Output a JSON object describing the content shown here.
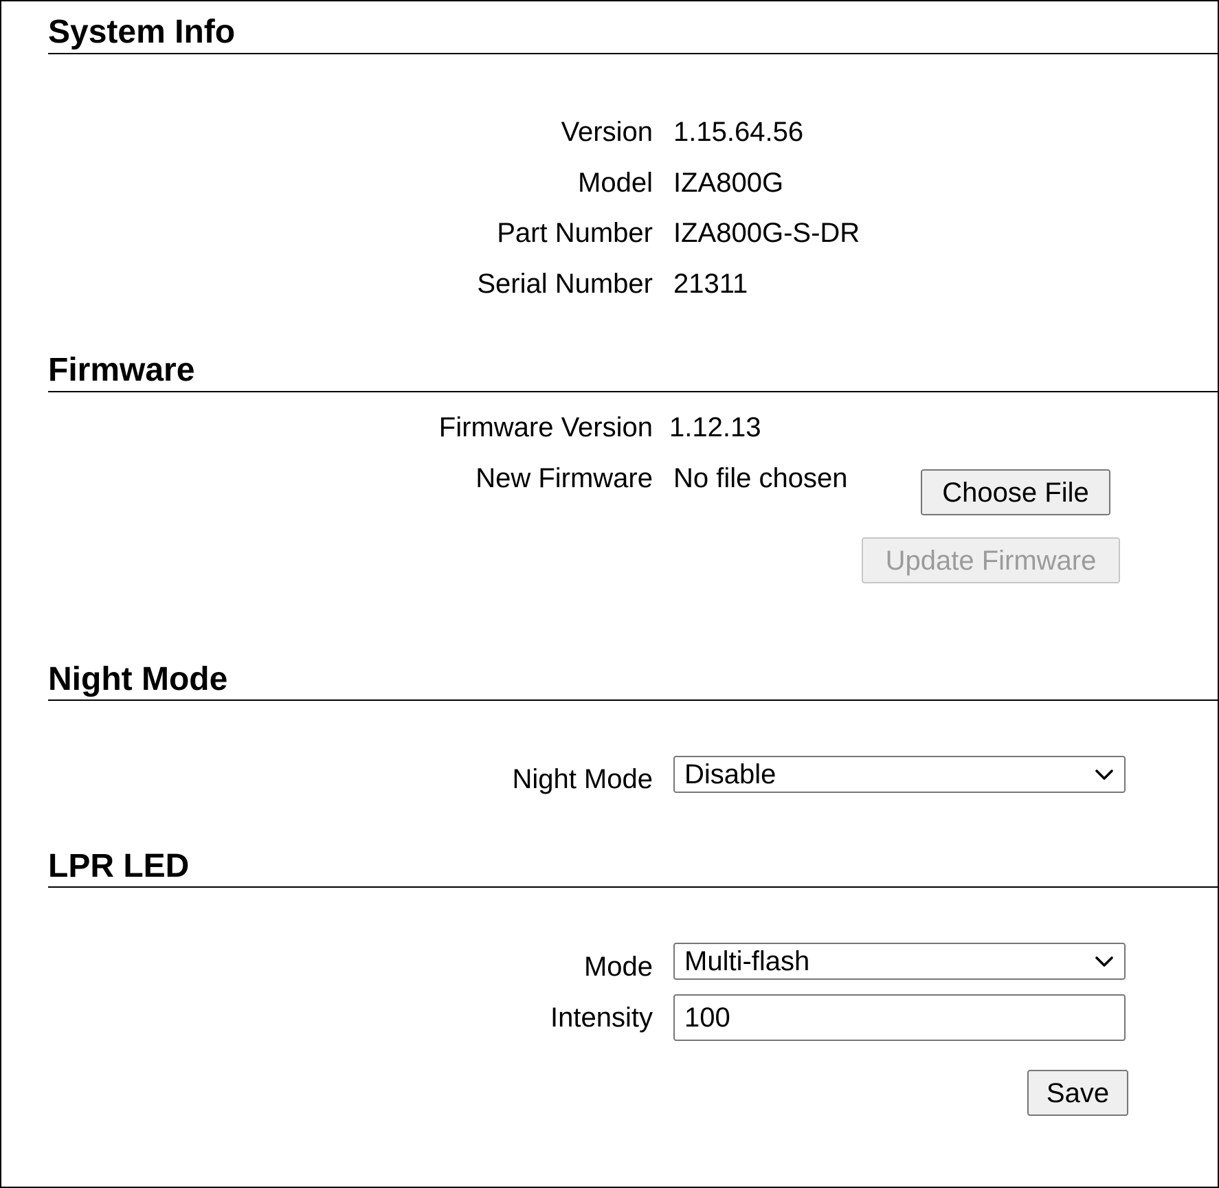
{
  "system_info": {
    "title": "System Info",
    "rows": [
      {
        "label": "Version",
        "value": "1.15.64.56"
      },
      {
        "label": "Model",
        "value": "IZA800G"
      },
      {
        "label": "Part Number",
        "value": "IZA800G-S-DR"
      },
      {
        "label": "Serial Number",
        "value": "21311"
      }
    ]
  },
  "firmware": {
    "title": "Firmware",
    "version_label": "Firmware Version",
    "version_value": "1.12.13",
    "new_label": "New Firmware",
    "file_status": "No file chosen",
    "choose_button": "Choose File",
    "update_button": "Update Firmware"
  },
  "night_mode": {
    "title": "Night Mode",
    "label": "Night Mode",
    "selected": "Disable"
  },
  "lpr_led": {
    "title": "LPR LED",
    "mode_label": "Mode",
    "mode_selected": "Multi-flash",
    "intensity_label": "Intensity",
    "intensity_value": "100",
    "save_button": "Save"
  },
  "icons": {
    "dropdown": "chevron-down-icon"
  },
  "colors": {
    "text": "#000000",
    "button_bg": "#efefef",
    "button_border": "#767676",
    "disabled_text": "#9b9b9b"
  }
}
